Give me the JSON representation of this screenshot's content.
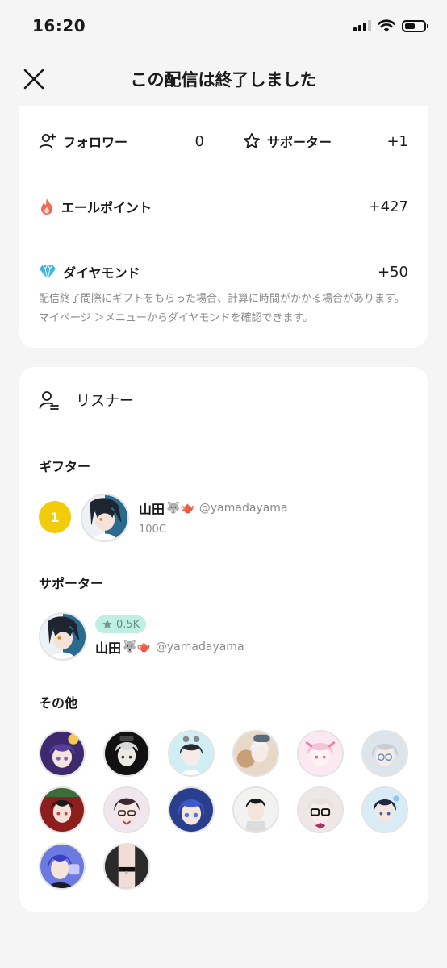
{
  "status_bar": {
    "time": "16:20"
  },
  "header": {
    "title": "この配信は終了しました"
  },
  "stats": {
    "followers": {
      "label": "フォロワー",
      "value": "0"
    },
    "supporters": {
      "label": "サポーター",
      "value": "+1"
    },
    "yell_points": {
      "label": "エールポイント",
      "value": "+427"
    },
    "diamonds": {
      "label": "ダイヤモンド",
      "value": "+50"
    },
    "note": "配信終了間際にギフトをもらった場合、計算に時間がかかる場合があります。マイページ ＞メニューからダイヤモンドを確認できます。"
  },
  "listeners": {
    "title": "リスナー",
    "gifter_section": "ギフター",
    "gifter": {
      "rank": "1",
      "name": "山田",
      "emoji": "🐺🫖",
      "handle": "@yamadayama",
      "amount": "100C"
    },
    "supporter_section": "サポーター",
    "supporter": {
      "badge": "0.5K",
      "name": "山田",
      "emoji": "🐺🫖",
      "handle": "@yamadayama"
    },
    "others_section": "その他"
  },
  "colors": {
    "rank_badge": "#f2cc0b",
    "support_badge": "#bdf0e3",
    "flame": "#f06a5a",
    "diamond": "#3cb4e8"
  }
}
